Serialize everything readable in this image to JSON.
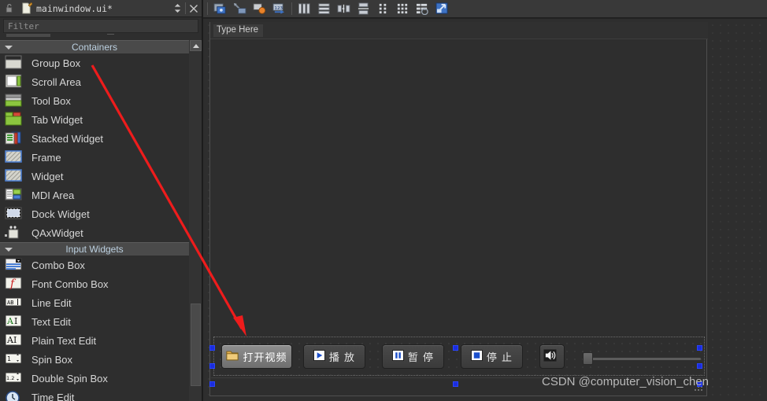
{
  "titlebar": {
    "lock_icon": "unlock-icon",
    "file_icon": "ui-file-icon",
    "filename": "mainwindow.ui*",
    "float_icon": "float-dock-icon",
    "close_icon": "close-icon"
  },
  "filter": {
    "placeholder": "Filter",
    "value": ""
  },
  "widget_box": {
    "groups": [
      {
        "label": "Containers",
        "collapse_icon": "chevron-down-icon",
        "items": [
          {
            "label": "Group Box",
            "icon": "group-box-icon"
          },
          {
            "label": "Scroll Area",
            "icon": "scroll-area-icon"
          },
          {
            "label": "Tool Box",
            "icon": "tool-box-icon"
          },
          {
            "label": "Tab Widget",
            "icon": "tab-widget-icon"
          },
          {
            "label": "Stacked Widget",
            "icon": "stacked-widget-icon"
          },
          {
            "label": "Frame",
            "icon": "frame-icon"
          },
          {
            "label": "Widget",
            "icon": "widget-icon"
          },
          {
            "label": "MDI Area",
            "icon": "mdi-area-icon"
          },
          {
            "label": "Dock Widget",
            "icon": "dock-widget-icon"
          },
          {
            "label": "QAxWidget",
            "icon": "qax-widget-icon"
          }
        ]
      },
      {
        "label": "Input Widgets",
        "collapse_icon": "chevron-down-icon",
        "items": [
          {
            "label": "Combo Box",
            "icon": "combo-box-icon"
          },
          {
            "label": "Font Combo Box",
            "icon": "font-combo-box-icon"
          },
          {
            "label": "Line Edit",
            "icon": "line-edit-icon"
          },
          {
            "label": "Text Edit",
            "icon": "text-edit-icon"
          },
          {
            "label": "Plain Text Edit",
            "icon": "plain-text-edit-icon"
          },
          {
            "label": "Spin Box",
            "icon": "spin-box-icon"
          },
          {
            "label": "Double Spin Box",
            "icon": "double-spin-box-icon"
          },
          {
            "label": "Time Edit",
            "icon": "time-edit-icon"
          }
        ]
      }
    ],
    "scrollbar": {
      "up_icon": "scroll-up-icon"
    }
  },
  "toolbar": {
    "buttons": [
      {
        "name": "edit-widgets-icon"
      },
      {
        "name": "edit-signals-slots-icon"
      },
      {
        "name": "edit-buddies-icon"
      },
      {
        "name": "edit-tab-order-icon"
      },
      {
        "name": "layout-horizontally-icon"
      },
      {
        "name": "layout-vertically-icon"
      },
      {
        "name": "layout-splitter-horizontal-icon"
      },
      {
        "name": "layout-splitter-vertical-icon"
      },
      {
        "name": "layout-form-icon"
      },
      {
        "name": "layout-grid-icon"
      },
      {
        "name": "break-layout-icon"
      },
      {
        "name": "adjust-size-icon"
      }
    ]
  },
  "form": {
    "menubar": {
      "placeholder": "Type Here"
    },
    "buttons": [
      {
        "label": "打开视频",
        "icon": "folder-open-icon",
        "state": "highlighted"
      },
      {
        "label": "播 放",
        "icon": "play-icon",
        "state": "normal"
      },
      {
        "label": "暂 停",
        "icon": "pause-icon",
        "state": "normal"
      },
      {
        "label": "停 止",
        "icon": "stop-icon",
        "state": "normal"
      },
      {
        "label": "",
        "icon": "volume-icon",
        "state": "normal"
      }
    ],
    "slider": {
      "name": "volume-slider",
      "value": 0,
      "min": 0,
      "max": 100
    },
    "size_grip_icon": "size-grip-icon"
  },
  "annotation": {
    "arrow": "red-arrow-annotation",
    "color": "#ee1c1c"
  },
  "watermark": {
    "text": "CSDN @computer_vision_chen"
  }
}
